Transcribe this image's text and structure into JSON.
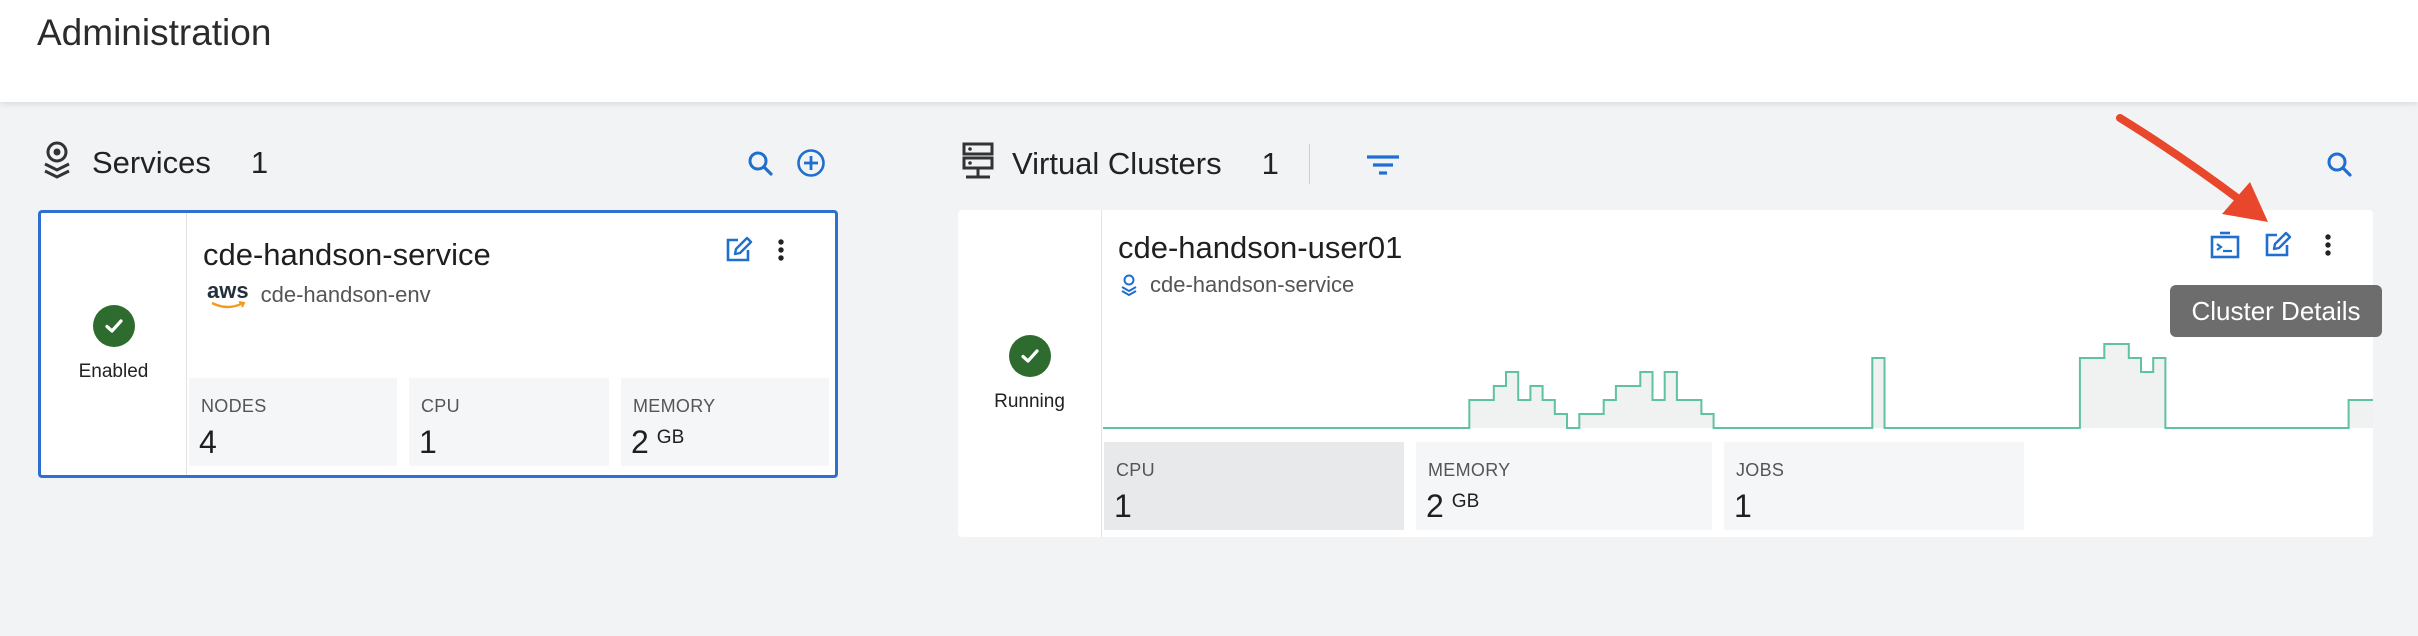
{
  "page": {
    "title": "Administration"
  },
  "services": {
    "title": "Services",
    "count": "1",
    "icons": {
      "section": "services-stack-icon",
      "search": "search-icon",
      "add": "add-circle-icon"
    },
    "card": {
      "status": "Enabled",
      "name": "cde-handson-service",
      "provider_logo": "aws",
      "environment": "cde-handson-env",
      "metrics": [
        {
          "label": "NODES",
          "value": "4",
          "unit": ""
        },
        {
          "label": "CPU",
          "value": "1",
          "unit": ""
        },
        {
          "label": "MEMORY",
          "value": "2",
          "unit": "GB"
        }
      ]
    }
  },
  "virtual_clusters": {
    "title": "Virtual Clusters",
    "count": "1",
    "icons": {
      "section": "server-rack-icon",
      "filter": "filter-icon",
      "search": "search-icon"
    },
    "card": {
      "status": "Running",
      "name": "cde-handson-user01",
      "service": "cde-handson-service",
      "tooltip": "Cluster Details",
      "sparkline": [
        0,
        0,
        0,
        0,
        0,
        0,
        0,
        0,
        0,
        0,
        0,
        0,
        0,
        0,
        0,
        0,
        0,
        0,
        0,
        0,
        0,
        0,
        0,
        0,
        0,
        0,
        0,
        0,
        0,
        0,
        2,
        2,
        3,
        4,
        2,
        3,
        2,
        1,
        0,
        1,
        1,
        2,
        3,
        3,
        4,
        2,
        4,
        2,
        2,
        1,
        0,
        0,
        0,
        0,
        0,
        0,
        0,
        0,
        0,
        0,
        0,
        0,
        0,
        5,
        0,
        0,
        0,
        0,
        0,
        0,
        0,
        0,
        0,
        0,
        0,
        0,
        0,
        0,
        0,
        0,
        5,
        5,
        6,
        6,
        5,
        4,
        5,
        0,
        0,
        0,
        0,
        0,
        0,
        0,
        0,
        0,
        0,
        0,
        0,
        0,
        0,
        0,
        2,
        2
      ],
      "metrics": [
        {
          "label": "CPU",
          "value": "1",
          "unit": ""
        },
        {
          "label": "MEMORY",
          "value": "2",
          "unit": "GB"
        },
        {
          "label": "JOBS",
          "value": "1",
          "unit": ""
        }
      ]
    }
  },
  "colors": {
    "accent": "#1f6fd1",
    "status_ok": "#2e6b2e",
    "sparkline": "#5fc2a0",
    "annotation_arrow": "#e8472b",
    "tooltip_bg": "#6d6d6d"
  }
}
